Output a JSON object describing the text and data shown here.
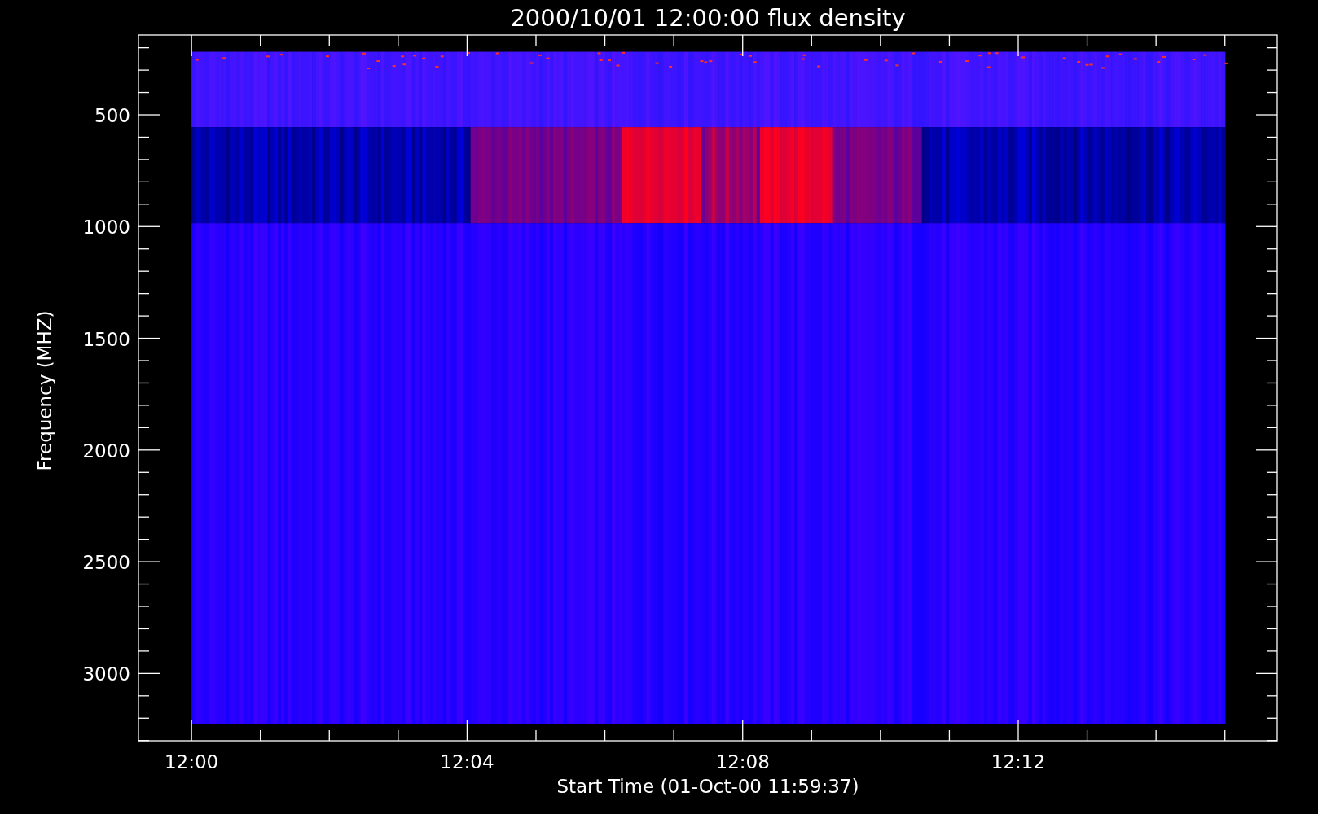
{
  "chart": {
    "title": "2000/10/01 12:00:00 flux density",
    "xlabel": "Start Time (01-Oct-00 11:59:37)",
    "ylabel": "Frequency (MHZ)",
    "xtick_labels": [
      "12:00",
      "12:04",
      "12:08",
      "12:12"
    ],
    "ytick_labels": [
      "500",
      "1000",
      "1500",
      "2000",
      "2500",
      "3000"
    ]
  }
}
